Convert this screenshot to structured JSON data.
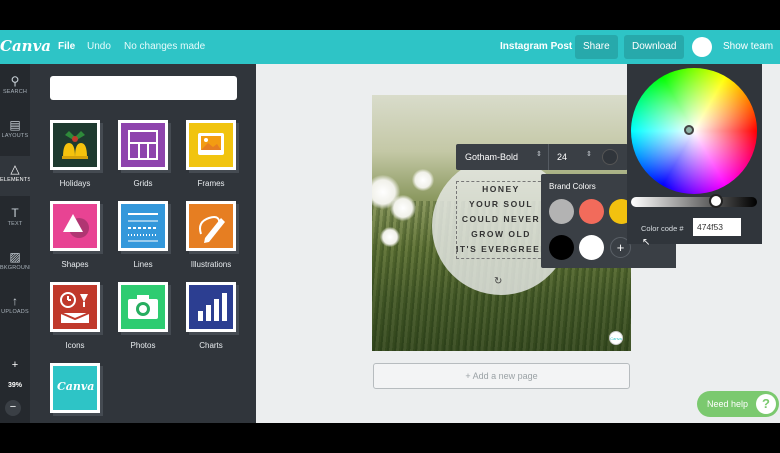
{
  "topbar": {
    "logo": "Canva",
    "file": "File",
    "undo": "Undo",
    "status": "No changes made",
    "doc_type": "Instagram Post",
    "share": "Share",
    "download": "Download",
    "show_team": "Show team"
  },
  "nav": {
    "items": [
      {
        "label": "SEARCH"
      },
      {
        "label": "LAYOUTS"
      },
      {
        "label": "ELEMENTS"
      },
      {
        "label": "TEXT"
      },
      {
        "label": "BKGROUND"
      },
      {
        "label": "UPLOADS"
      }
    ],
    "zoom_plus": "+",
    "zoom": "39%",
    "zoom_minus": "−"
  },
  "panel": {
    "search_placeholder": "",
    "tiles": [
      {
        "label": "Holidays",
        "color": "#1e3a2f",
        "icon": "bells-icon"
      },
      {
        "label": "Grids",
        "color": "#8e44ad",
        "icon": "grid-icon"
      },
      {
        "label": "Frames",
        "color": "#f1c40f",
        "icon": "frame-icon"
      },
      {
        "label": "Shapes",
        "color": "#e84393",
        "icon": "shapes-icon"
      },
      {
        "label": "Lines",
        "color": "#3498db",
        "icon": "lines-icon"
      },
      {
        "label": "Illustrations",
        "color": "#e67e22",
        "icon": "pencil-icon"
      },
      {
        "label": "Icons",
        "color": "#c0392b",
        "icon": "icons-icon"
      },
      {
        "label": "Photos",
        "color": "#2ecc71",
        "icon": "camera-icon"
      },
      {
        "label": "Charts",
        "color": "#2c3e91",
        "icon": "chart-icon"
      },
      {
        "label": "",
        "color": "#2ec4c6",
        "icon": "canva-logo-icon",
        "logo_text": "Canva"
      }
    ]
  },
  "design": {
    "quote": [
      "HONEY",
      "YOUR SOUL",
      "COULD NEVER",
      "GROW OLD",
      "IT'S EVERGREEN"
    ],
    "add_page": "+ Add a new page"
  },
  "text_toolbar": {
    "font": "Gotham-Bold",
    "size": "24"
  },
  "brand_colors": {
    "title": "Brand Colors",
    "swatches": [
      "#b3b3b3",
      "#f26b5b",
      "#f2c10f",
      "#000000",
      "#ffffff"
    ]
  },
  "color_picker": {
    "code_label": "Color code #",
    "code_value": "474f53"
  },
  "help": {
    "label": "Need help",
    "q": "?"
  }
}
